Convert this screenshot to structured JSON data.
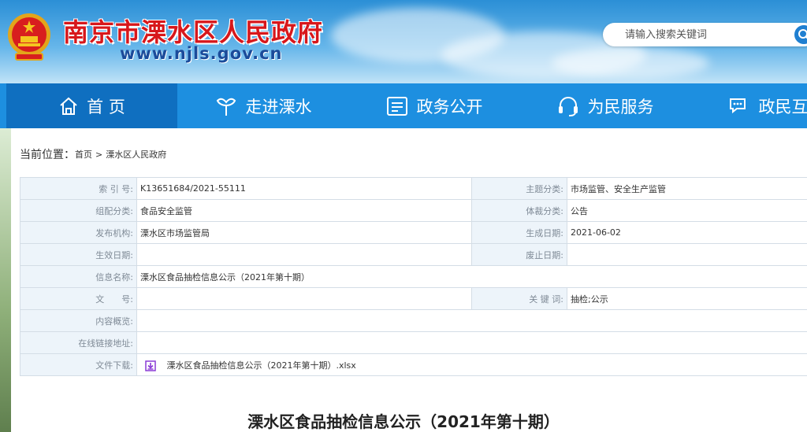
{
  "header": {
    "site_title": "南京市溧水区人民政府",
    "site_domain": "www.njls.gov.cn",
    "search_placeholder": "请输入搜索关键词"
  },
  "nav": {
    "items": [
      {
        "label": "首 页",
        "icon": "home-icon",
        "active": true
      },
      {
        "label": "走进溧水",
        "icon": "ginkgo-leaf-icon",
        "active": false
      },
      {
        "label": "政务公开",
        "icon": "document-icon",
        "active": false
      },
      {
        "label": "为民服务",
        "icon": "headset-icon",
        "active": false
      },
      {
        "label": "政民互动",
        "icon": "chat-bubble-icon",
        "active": false
      }
    ]
  },
  "breadcrumb": {
    "label": "当前位置：",
    "home": "首页",
    "separator": ">",
    "current": "溧水区人民政府"
  },
  "info": {
    "index_label": "索 引 号:",
    "index_value": "K13651684/2021-55111",
    "topic_label": "主题分类:",
    "topic_value": "市场监管、安全生产监管",
    "org_class_label": "组配分类:",
    "org_class_value": "食品安全监管",
    "genre_label": "体裁分类:",
    "genre_value": "公告",
    "publisher_label": "发布机构:",
    "publisher_value": "溧水区市场监管局",
    "created_label": "生成日期:",
    "created_value": "2021-06-02",
    "effective_label": "生效日期:",
    "effective_value": "",
    "abolish_label": "废止日期:",
    "abolish_value": "",
    "name_label": "信息名称:",
    "name_value": "溧水区食品抽检信息公示（2021年第十期）",
    "docno_label": "文　　号:",
    "docno_value": "",
    "keywords_label": "关 键 词:",
    "keywords_value": "抽检;公示",
    "summary_label": "内容概览:",
    "summary_value": "",
    "link_label": "在线链接地址:",
    "link_value": "",
    "download_label": "文件下载:",
    "download_file": "溧水区食品抽检信息公示（2021年第十期）.xlsx"
  },
  "document": {
    "title": "溧水区食品抽检信息公示（2021年第十期）"
  },
  "colors": {
    "title_red": "#d7171b",
    "nav_blue": "#1d8fe0",
    "nav_active": "#0f6fc0",
    "label_bg": "#edf4fa",
    "download_icon": "#8a3bd6"
  }
}
